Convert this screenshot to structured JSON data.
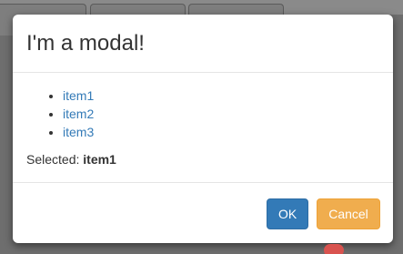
{
  "modal": {
    "title": "I'm a modal!",
    "items": [
      "item1",
      "item2",
      "item3"
    ],
    "selected_label": "Selected:",
    "selected_value": "item1",
    "ok_label": "OK",
    "cancel_label": "Cancel"
  },
  "colors": {
    "primary": "#337ab7",
    "warning": "#f0ad4e",
    "link": "#337ab7"
  }
}
